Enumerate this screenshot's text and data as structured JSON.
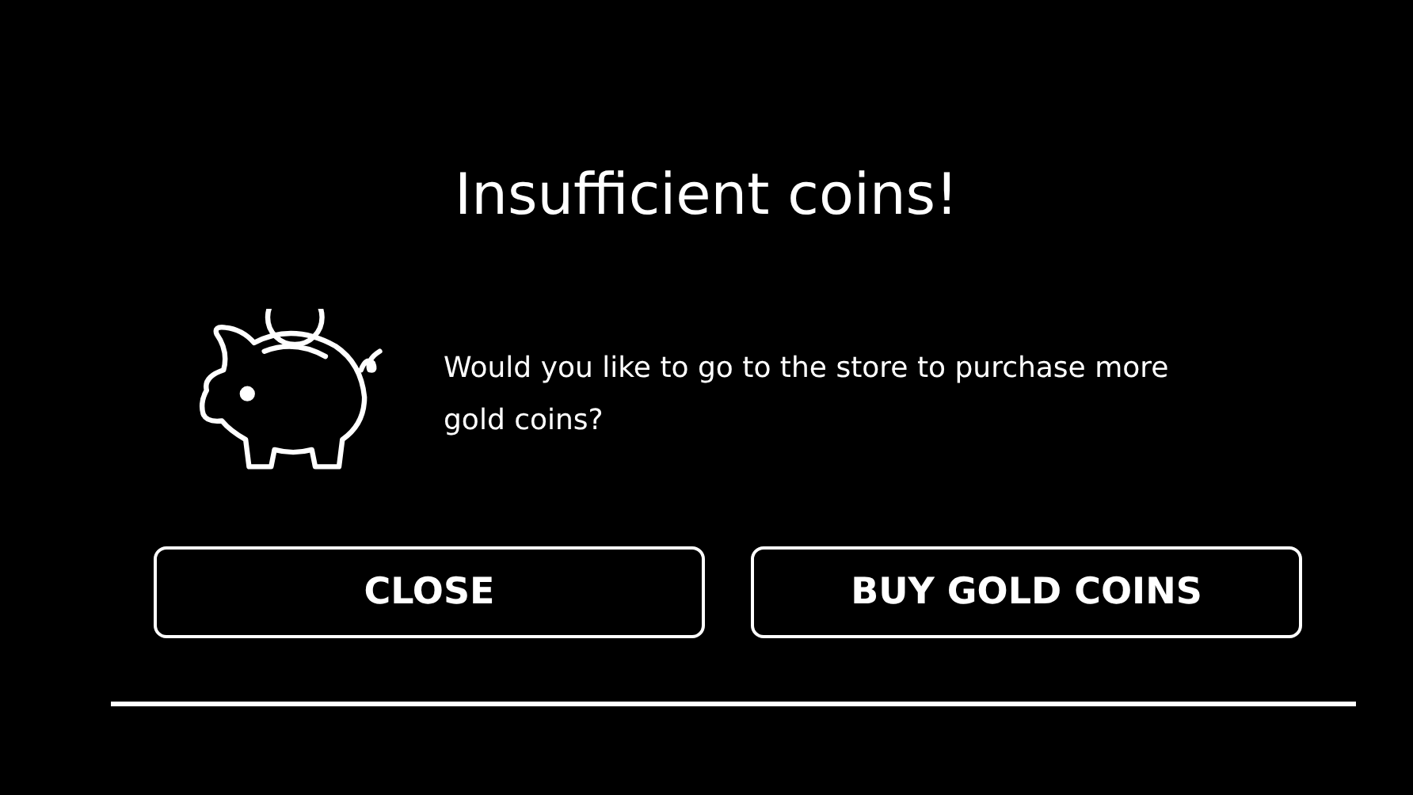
{
  "dialog": {
    "title": "Insufficient coins!",
    "message": "Would you like to go to the store to purchase more gold coins?",
    "buttons": [
      "CLOSE",
      "BUY GOLD COINS"
    ]
  }
}
